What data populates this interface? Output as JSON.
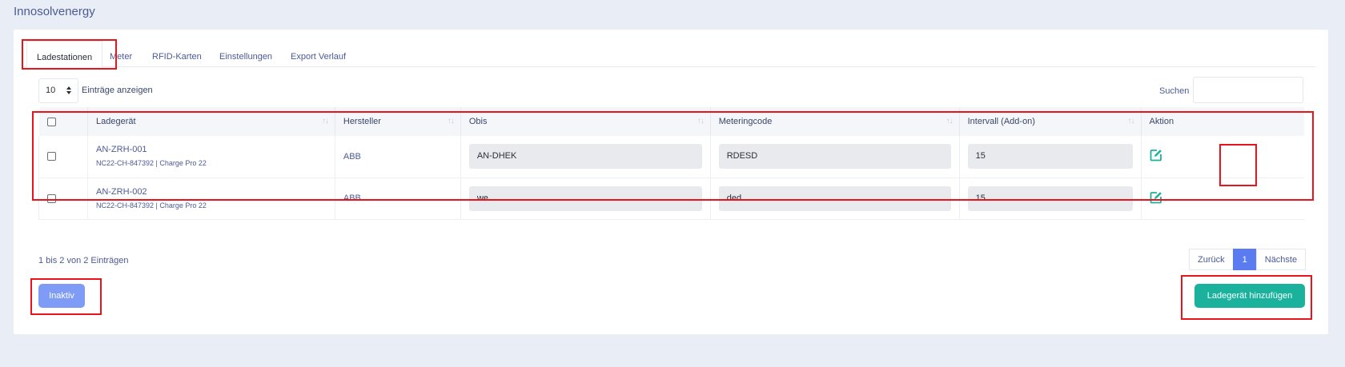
{
  "app": {
    "title": "Innosolvenergy"
  },
  "tabs": [
    {
      "label": "Ladestationen",
      "active": true
    },
    {
      "label": "Meter"
    },
    {
      "label": "RFID-Karten"
    },
    {
      "label": "Einstellungen"
    },
    {
      "label": "Export Verlauf"
    }
  ],
  "controls": {
    "page_length": "10",
    "page_length_label": "Einträge anzeigen",
    "search_label": "Suchen",
    "search_value": ""
  },
  "table": {
    "columns": [
      "Ladegerät",
      "Hersteller",
      "Obis",
      "Meteringcode",
      "Intervall (Add-on)",
      "Aktion"
    ],
    "rows": [
      {
        "name": "AN-ZRH-001",
        "sub": "NC22-CH-847392 | Charge Pro 22",
        "manufacturer": "ABB",
        "obis": "AN-DHEK",
        "metering_code": "RDESD",
        "interval": "15"
      },
      {
        "name": "AN-ZRH-002",
        "sub": "NC22-CH-847392 | Charge Pro 22",
        "manufacturer": "ABB",
        "obis": "we",
        "metering_code": "ded",
        "interval": "15"
      }
    ]
  },
  "footer": {
    "info": "1 bis 2 von 2 Einträgen",
    "prev": "Zurück",
    "current_page": "1",
    "next": "Nächste",
    "inactive_button": "Inaktiv",
    "add_button": "Ladegerät hinzufügen"
  },
  "colors": {
    "accent": "#1ab29c",
    "primary": "#5b7bf0",
    "highlight": "#e8131b"
  }
}
